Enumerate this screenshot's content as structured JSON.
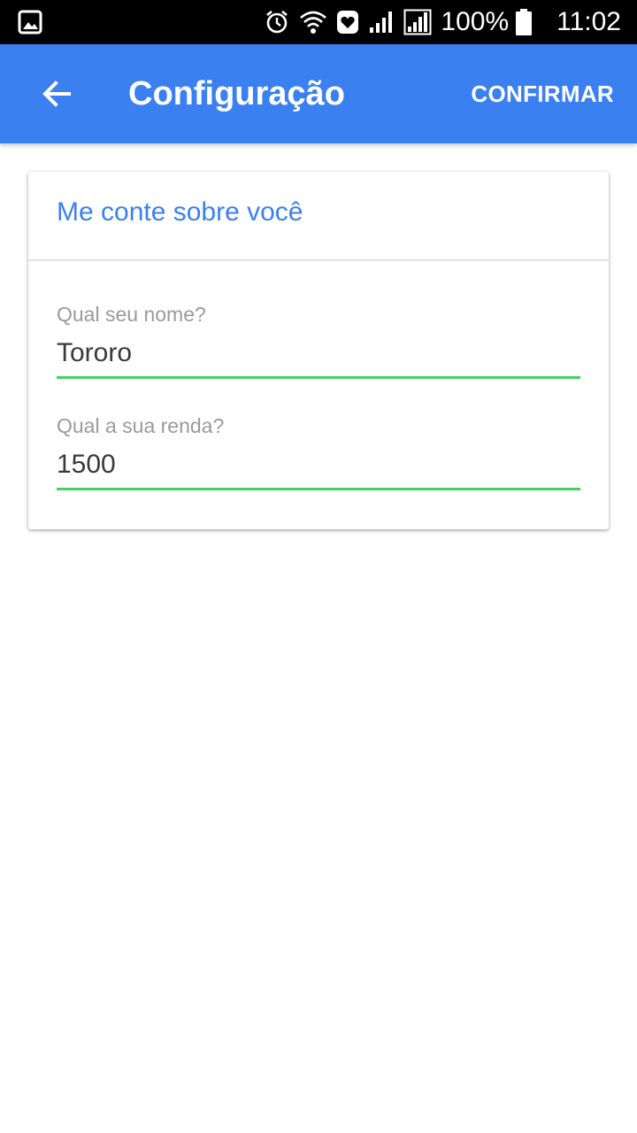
{
  "status_bar": {
    "icons_left": [
      "gallery-notification-icon"
    ],
    "icons_right": [
      "alarm-icon",
      "wifi-icon",
      "heart-app-icon",
      "signal-icon",
      "signal-icon-2"
    ],
    "battery": "100%",
    "time": "11:02"
  },
  "app_bar": {
    "title": "Configuração",
    "back_icon": "arrow-back-icon",
    "confirm_label": "CONFIRMAR",
    "color": "#3b80f0"
  },
  "card": {
    "title": "Me conte sobre você",
    "fields": [
      {
        "label": "Qual seu nome?",
        "value": "Tororo"
      },
      {
        "label": "Qual a sua renda?",
        "value": "1500"
      }
    ],
    "accent": "#45d160"
  }
}
